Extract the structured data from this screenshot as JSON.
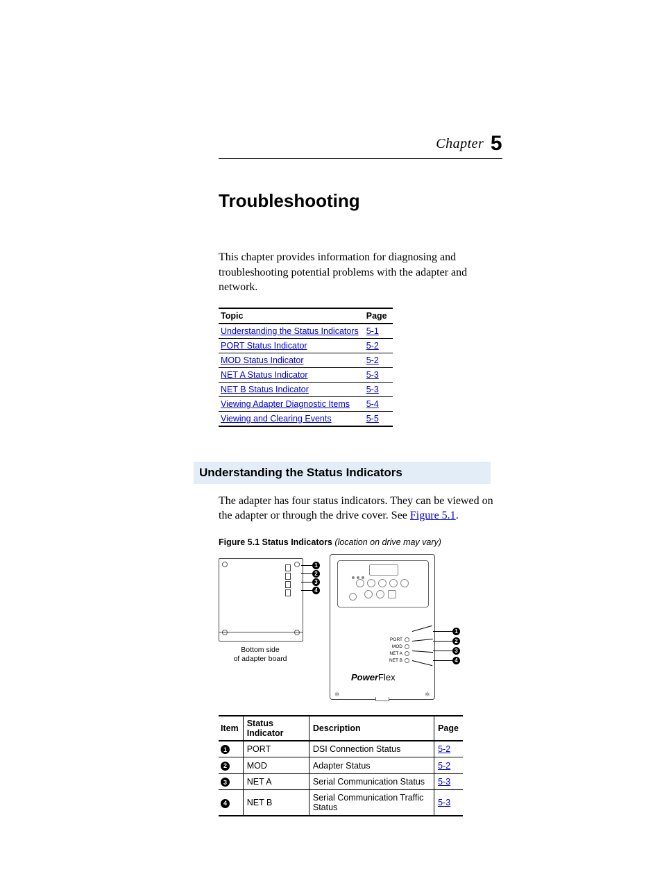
{
  "chapter": {
    "label": "Chapter",
    "number": "5"
  },
  "title": "Troubleshooting",
  "intro": "This chapter provides information for diagnosing and troubleshooting potential problems with the adapter and network.",
  "topic_table": {
    "headers": {
      "topic": "Topic",
      "page": "Page"
    },
    "rows": [
      {
        "topic": "Understanding the Status Indicators",
        "page": "5-1"
      },
      {
        "topic": "PORT Status Indicator",
        "page": "5-2"
      },
      {
        "topic": "MOD Status Indicator",
        "page": "5-2"
      },
      {
        "topic": "NET A Status Indicator",
        "page": "5-3"
      },
      {
        "topic": "NET B Status Indicator",
        "page": "5-3"
      },
      {
        "topic": "Viewing Adapter Diagnostic Items",
        "page": "5-4"
      },
      {
        "topic": "Viewing and Clearing Events",
        "page": "5-5"
      }
    ]
  },
  "section1": {
    "heading": "Understanding the Status Indicators",
    "para_a": "The adapter has four status indicators. They can be viewed on the adapter or through the drive cover. See ",
    "para_link": "Figure 5.1",
    "para_b": "."
  },
  "figure": {
    "label": "Figure 5.1   Status Indicators ",
    "note": "(location on drive may vary)",
    "board_caption_l1": "Bottom side",
    "board_caption_l2": "of adapter board",
    "leds": {
      "port": "PORT",
      "mod": "MOD",
      "neta": "NET A",
      "netb": "NET B"
    },
    "brand_bold": "Power",
    "brand_light": "Flex"
  },
  "indicator_table": {
    "headers": {
      "item": "Item",
      "ind": "Status Indicator",
      "desc": "Description",
      "page": "Page"
    },
    "rows": [
      {
        "n": "1",
        "ind": "PORT",
        "desc": "DSI Connection Status",
        "page": "5-2"
      },
      {
        "n": "2",
        "ind": "MOD",
        "desc": "Adapter Status",
        "page": "5-2"
      },
      {
        "n": "3",
        "ind": "NET A",
        "desc": "Serial Communication Status",
        "page": "5-3"
      },
      {
        "n": "4",
        "ind": "NET B",
        "desc": "Serial Communication Traffic Status",
        "page": "5-3"
      }
    ]
  }
}
